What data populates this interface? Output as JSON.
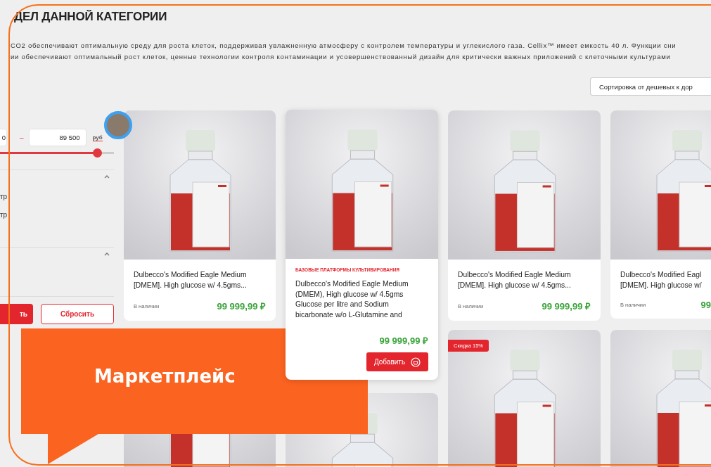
{
  "page": {
    "heading": "ДЕЛ ДАННОЙ КАТЕГОРИИ",
    "description": [
      "СО2 обеспечивают оптимальную среду для роста клеток, поддерживая увлажненную атмосферу с контролем температуры и углекислого газа. Cellix™ имеет емкость 40 л. Функции сни",
      "ии обеспечивают оптимальный рост клеток, ценные технологии контроля контаминации и усовершенствованный дизайн для критически важных приложений с клеточными культурами"
    ]
  },
  "sort": {
    "label": "Сортировка от дешевых к дор"
  },
  "filters": {
    "price_from": "0",
    "dash": "–",
    "price_to": "89 500",
    "unit": "руб",
    "slider": {
      "level": 0.85
    },
    "sections": [
      {
        "expanded": true,
        "items": [
          "тр",
          "тр"
        ]
      },
      {
        "expanded": true
      }
    ],
    "buttons": {
      "apply": "ть",
      "reset": "Сбросить"
    }
  },
  "products": [
    {
      "kind": "card",
      "title_lines": [
        "Dulbecco's Modified Eagle Medium",
        "[DMEM]. High glucose  w/ 4.5gms..."
      ],
      "availability": "В наличии",
      "price": "99 999,99 ₽"
    },
    {
      "kind": "expanded",
      "category": "БАЗОВЫЕ ПЛАТФОРМЫ КУЛЬТИВИРОВАНИЯ",
      "title_lines": [
        "Dulbecco's Modified Eagle Medium",
        "(DMEM), High glucose  w/ 4.5gms",
        "Glucose per litre and Sodium",
        "bicarbonate w/o L-Glutamine and"
      ],
      "price": "99 999,99 ₽",
      "button": "Добавить"
    },
    {
      "kind": "card",
      "title_lines": [
        "Dulbecco's Modified Eagle Medium",
        "[DMEM]. High glucose  w/ 4.5gms..."
      ],
      "availability": "В наличии",
      "price": "99 999,99 ₽"
    },
    {
      "kind": "card",
      "title_lines": [
        "Dulbecco's Modified Eagl",
        "[DMEM]. High glucose  w/"
      ],
      "availability": "В наличии",
      "price": "99"
    },
    {
      "kind": "image"
    },
    {
      "kind": "image"
    },
    {
      "kind": "image",
      "badge": "Скидка 15%"
    },
    {
      "kind": "image"
    }
  ],
  "callout": {
    "title": "Маркетплейс"
  }
}
